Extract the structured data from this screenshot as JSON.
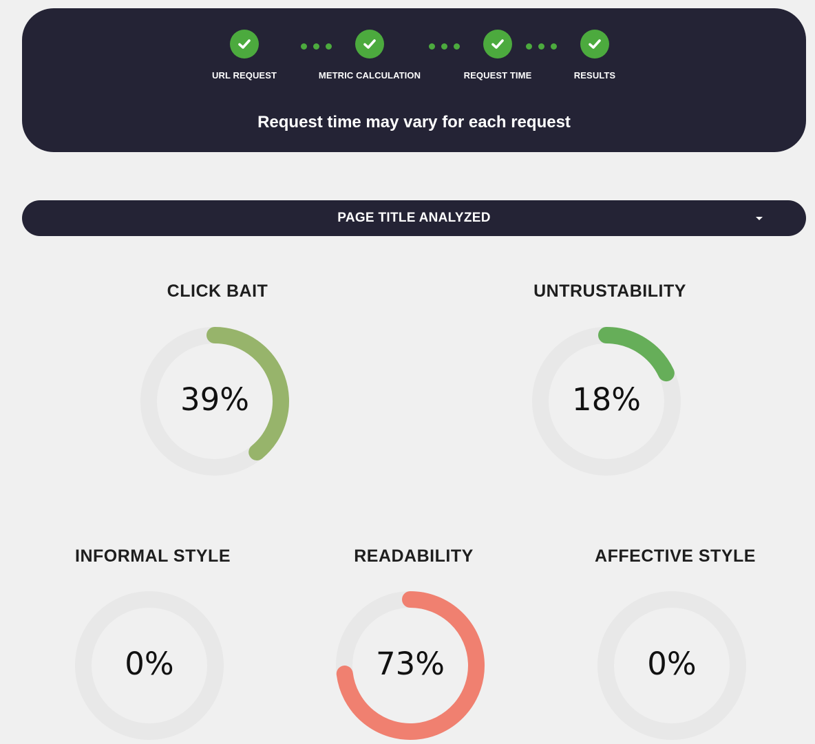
{
  "progress": {
    "steps": [
      {
        "label": "URL REQUEST",
        "status": "complete"
      },
      {
        "label": "METRIC CALCULATION",
        "status": "complete"
      },
      {
        "label": "REQUEST TIME",
        "status": "complete"
      },
      {
        "label": "RESULTS",
        "status": "complete"
      }
    ],
    "notice": "Request time may vary for each request",
    "check_color": "#4caa3e"
  },
  "section": {
    "title": "PAGE TITLE ANALYZED"
  },
  "metrics": [
    {
      "title": "CLICK BAIT",
      "value": 39,
      "value_text": "39%",
      "color": "#97b46b"
    },
    {
      "title": "UNTRUSTABILITY",
      "value": 18,
      "value_text": "18%",
      "color": "#66ae59"
    },
    {
      "title": "INFORMAL STYLE",
      "value": 0,
      "value_text": "0%",
      "color": "#66ae59"
    },
    {
      "title": "READABILITY",
      "value": 73,
      "value_text": "73%",
      "color": "#f08070"
    },
    {
      "title": "AFFECTIVE STYLE",
      "value": 0,
      "value_text": "0%",
      "color": "#66ae59"
    }
  ],
  "colors": {
    "panel_bg": "#242335",
    "page_bg": "#f0f0f0",
    "track": "#e8e8e8"
  }
}
